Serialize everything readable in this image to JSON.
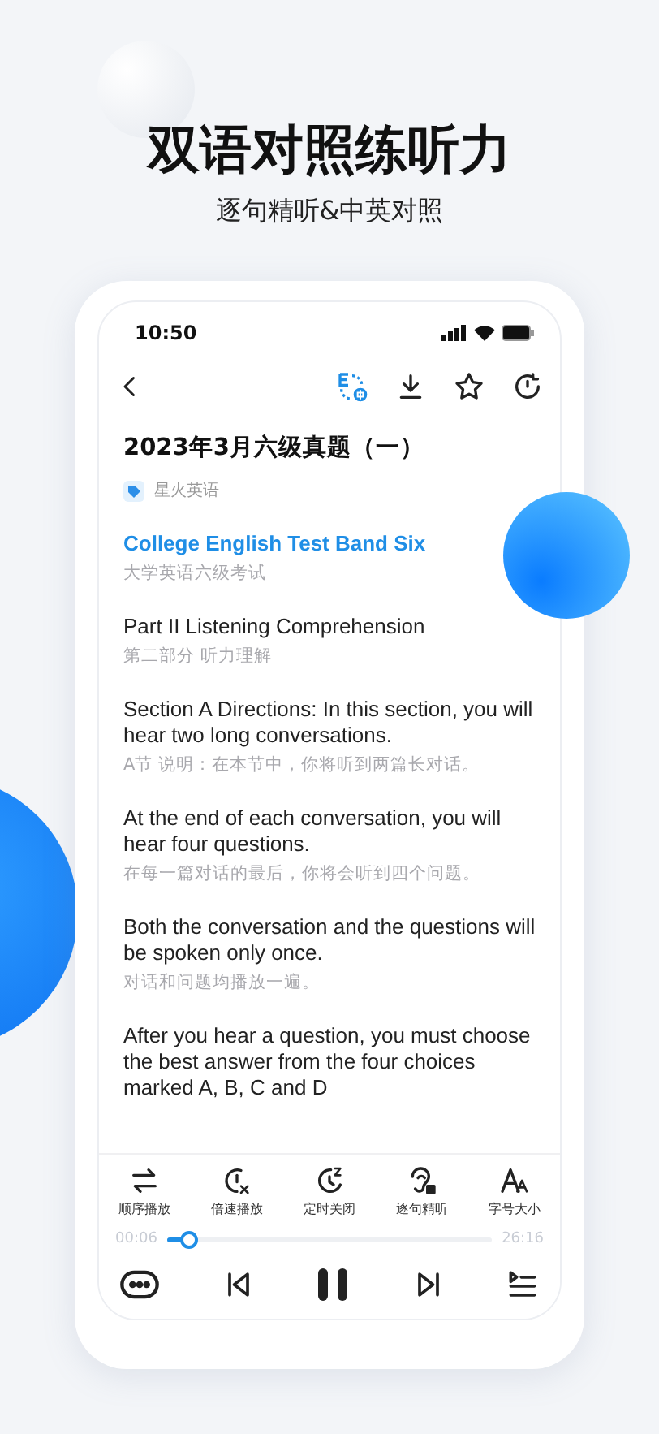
{
  "headline": "双语对照练听力",
  "subheadline": "逐句精听&中英对照",
  "status_bar": {
    "time": "10:50"
  },
  "article": {
    "title": "2023年3月六级真题（一）",
    "tag": "星火英语",
    "paragraphs": [
      {
        "en": "College English Test Band Six",
        "zh": "大学英语六级考试",
        "playing": true
      },
      {
        "en": "Part II  Listening Comprehension",
        "zh": "第二部分 听力理解",
        "playing": false
      },
      {
        "en": "Section A Directions: In this section, you will hear two long conversations.",
        "zh": "A节 说明：在本节中，你将听到两篇长对话。",
        "playing": false
      },
      {
        "en": "At the end of each conversation, you will hear four questions.",
        "zh": "在每一篇对话的最后，你将会听到四个问题。",
        "playing": false
      },
      {
        "en": "Both the conversation and the questions will be spoken only once.",
        "zh": "对话和问题均播放一遍。",
        "playing": false
      },
      {
        "en": "After you hear a question, you must choose the best answer from the four choices marked A, B, C and D",
        "playing": false
      }
    ]
  },
  "player": {
    "controls": [
      {
        "label": "顺序播放"
      },
      {
        "label": "倍速播放"
      },
      {
        "label": "定时关闭"
      },
      {
        "label": "逐句精听"
      },
      {
        "label": "字号大小"
      }
    ],
    "elapsed": "00:06",
    "duration": "26:16",
    "level": 0.07,
    "playing": true
  }
}
